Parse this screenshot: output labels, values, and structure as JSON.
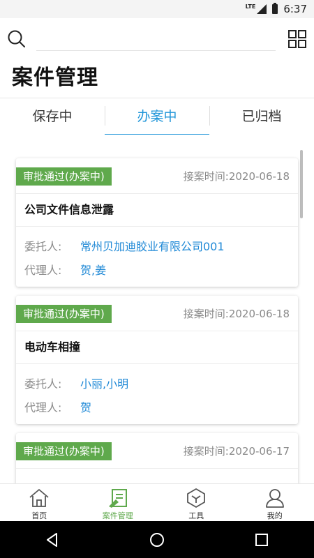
{
  "status_bar": {
    "network": "LTE",
    "time": "6:37"
  },
  "header": {
    "title": "案件管理"
  },
  "tabs": [
    {
      "label": "保存中"
    },
    {
      "label": "办案中"
    },
    {
      "label": "已归档"
    }
  ],
  "labels": {
    "client": "委托人:",
    "agent": "代理人:"
  },
  "cases": [
    {
      "status": "审批通过(办案中)",
      "date": "接案时间:2020-06-18",
      "title": "公司文件信息泄露",
      "client": "常州贝加迪胶业有限公司001",
      "agent": "贺,姜"
    },
    {
      "status": "审批通过(办案中)",
      "date": "接案时间:2020-06-18",
      "title": "电动车相撞",
      "client": "小丽,小明",
      "agent": "贺"
    },
    {
      "status": "审批通过(办案中)",
      "date": "接案时间:2020-06-17"
    }
  ],
  "bottom_nav": [
    {
      "label": "首页",
      "icon": "home-icon"
    },
    {
      "label": "案件管理",
      "icon": "case-icon"
    },
    {
      "label": "工具",
      "icon": "tools-icon"
    },
    {
      "label": "我的",
      "icon": "profile-icon"
    }
  ],
  "colors": {
    "accent": "#2196d9",
    "badge": "#5fa94c",
    "link": "#1e88d6"
  }
}
